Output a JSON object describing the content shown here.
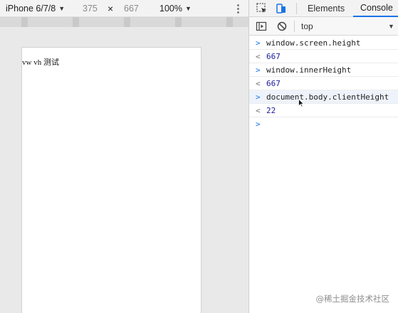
{
  "device_toolbar": {
    "device_name": "iPhone 6/7/8",
    "width": "375",
    "times": "×",
    "height": "667",
    "zoom": "100%"
  },
  "device_page": {
    "text": "vw vh 测试"
  },
  "devtools": {
    "tabs": [
      {
        "label": "Elements"
      },
      {
        "label": "Console",
        "active": true
      }
    ]
  },
  "console_toolbar": {
    "context": "top"
  },
  "console": {
    "lines": [
      {
        "kind": "input",
        "prompt": ">",
        "text": "window.screen.height"
      },
      {
        "kind": "result",
        "prompt": "<",
        "text": "667"
      },
      {
        "kind": "input",
        "prompt": ">",
        "text": "window.innerHeight"
      },
      {
        "kind": "result",
        "prompt": "<",
        "text": "667"
      },
      {
        "kind": "input",
        "prompt": ">",
        "text": "document.body.clientHeight"
      },
      {
        "kind": "result",
        "prompt": "<",
        "text": "22"
      }
    ],
    "input_prompt": ">"
  },
  "watermark": "@稀土掘金技术社区",
  "colors": {
    "accent": "#1a73e8",
    "result_text": "#1c1c9c"
  }
}
